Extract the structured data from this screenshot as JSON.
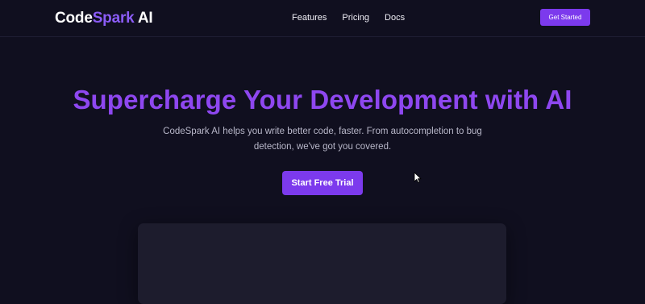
{
  "navbar": {
    "logo": {
      "part1": "Code",
      "part2": "Spark",
      "part3": " AI"
    },
    "links": [
      "Features",
      "Pricing",
      "Docs"
    ],
    "cta_label": "Get Started"
  },
  "hero": {
    "title": "Supercharge Your Development with AI",
    "subtitle": "CodeSpark AI helps you write better code, faster. From autocompletion to bug detection, we've got you covered.",
    "cta_label": "Start Free Trial"
  },
  "colors": {
    "background": "#100f1f",
    "accent": "#7c3aed",
    "title": "#8e47f0",
    "panel": "#1d1c2d"
  },
  "icons": {
    "cursor": "mouse-pointer-icon"
  }
}
